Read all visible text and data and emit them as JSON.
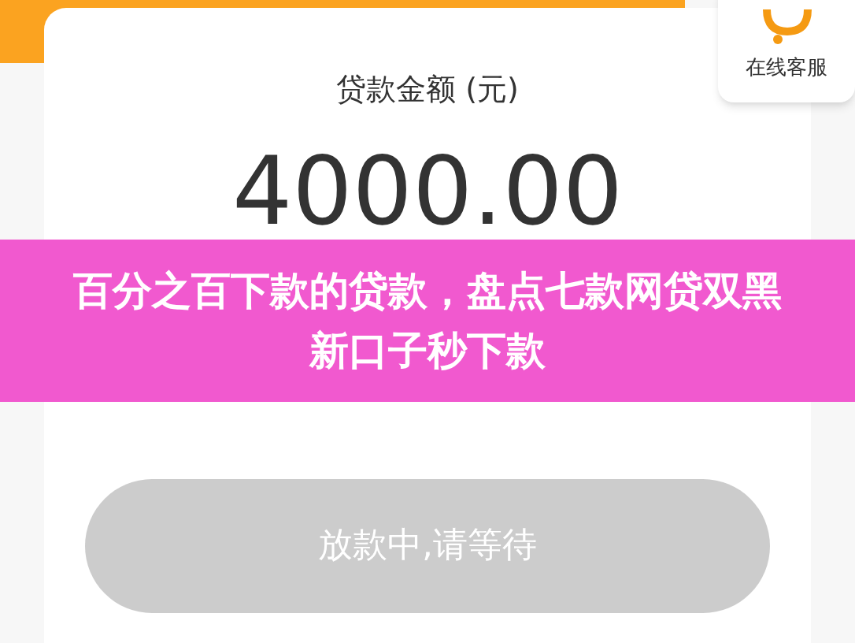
{
  "service": {
    "label": "在线客服"
  },
  "loan": {
    "label": "贷款金额 (元)",
    "amount": "4000.00"
  },
  "submit_button": {
    "label": "放款中,请等待",
    "disabled": true
  },
  "banner": {
    "title": "百分之百下款的贷款，盘点七款网贷双黑新口子秒下款"
  }
}
